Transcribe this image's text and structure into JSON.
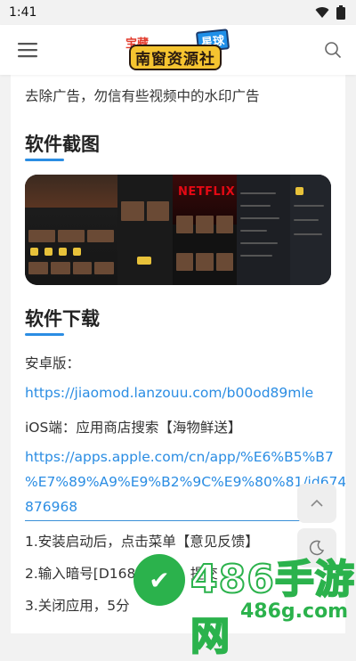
{
  "status": {
    "time": "1:41"
  },
  "header": {
    "logo_top": "宝藏",
    "logo_tag": "星球",
    "logo_main": "南窗资源社",
    "menu_icon": "menu-icon",
    "search_icon": "search-icon"
  },
  "content": {
    "intro_line": "去除广告，勿信有些视频中的水印广告",
    "screens_heading": "软件截图",
    "netflix_label": "NETFLIX",
    "download_heading": "软件下载",
    "android_label": "安卓版：",
    "android_link": "https://jiaomod.lanzouu.com/b00od89mle",
    "ios_label": "iOS端：应用商店搜索【海物鲜送】",
    "ios_link_line1": "https://apps.apple.com/cn/app/%E6%B5%B7",
    "ios_link_line2": "%E7%89%A9%E9%B2%9C%E9%80%81/id6749",
    "ios_link_line3": "876968",
    "step1": "1.安装启动后，点击菜单【意见反馈】",
    "step2": "2.输入暗号[D168]",
    "step2_tail": "】提交",
    "step3": "3.关闭应用，5分"
  },
  "watermark": {
    "brand": "486手游网",
    "domain": "486g.com",
    "logo_glyph": "✔"
  },
  "colors": {
    "accent": "#2b8de3",
    "watermark_green": "#2bb24c"
  }
}
